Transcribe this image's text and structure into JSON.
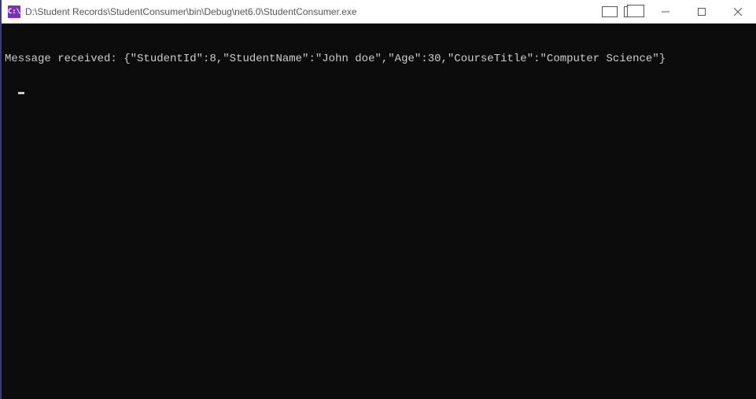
{
  "window": {
    "icon_label": "C:\\",
    "title": "D:\\Student Records\\StudentConsumer\\bin\\Debug\\net6.0\\StudentConsumer.exe",
    "controls": {
      "minimize": "Minimize",
      "maximize": "Maximize",
      "close": "Close"
    }
  },
  "console": {
    "output_line": "Message received: {\"StudentId\":8,\"StudentName\":\"John doe\",\"Age\":30,\"CourseTitle\":\"Computer Science\"}"
  },
  "colors": {
    "console_bg": "#0c0c0c",
    "console_fg": "#cccccc",
    "titlebar_bg": "#ffffff",
    "accent": "#7b2fbf"
  }
}
